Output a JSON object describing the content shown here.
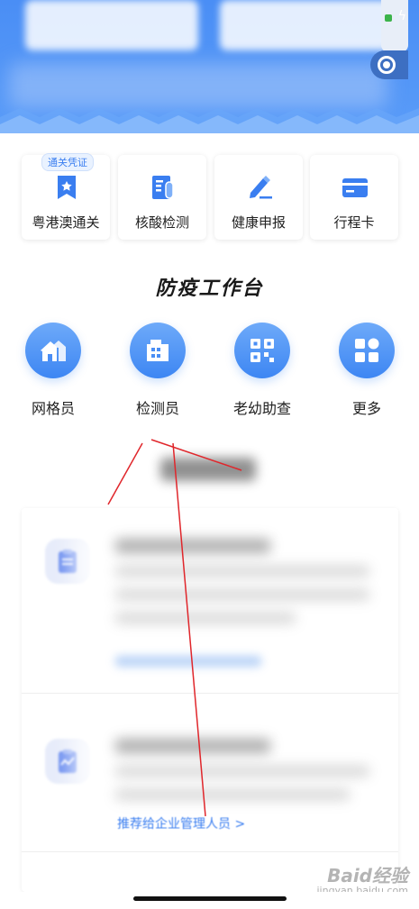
{
  "header": {
    "blurred_content": true
  },
  "quick_services": [
    {
      "label": "粤港澳通关",
      "badge": "通关凭证",
      "icon": "ribbon-badge-icon"
    },
    {
      "label": "核酸检测",
      "icon": "test-tube-report-icon"
    },
    {
      "label": "健康申报",
      "icon": "pen-sign-icon"
    },
    {
      "label": "行程卡",
      "icon": "card-icon"
    }
  ],
  "workbench": {
    "title": "防疫工作台",
    "items": [
      {
        "label": "网格员",
        "icon": "house-icon"
      },
      {
        "label": "检测员",
        "icon": "building-icon"
      },
      {
        "label": "老幼助查",
        "icon": "qr-scan-icon"
      },
      {
        "label": "更多",
        "icon": "grid-apps-icon"
      }
    ]
  },
  "tasks": {
    "link_text": "推荐给企业管理人员 >"
  },
  "watermark": {
    "main": "Baid经验",
    "sub": "jingyan.baidu.com"
  },
  "colors": {
    "brand_blue": "#4a8ef5",
    "link_blue": "#3a7ef0",
    "annotation_red": "#e0262b"
  }
}
